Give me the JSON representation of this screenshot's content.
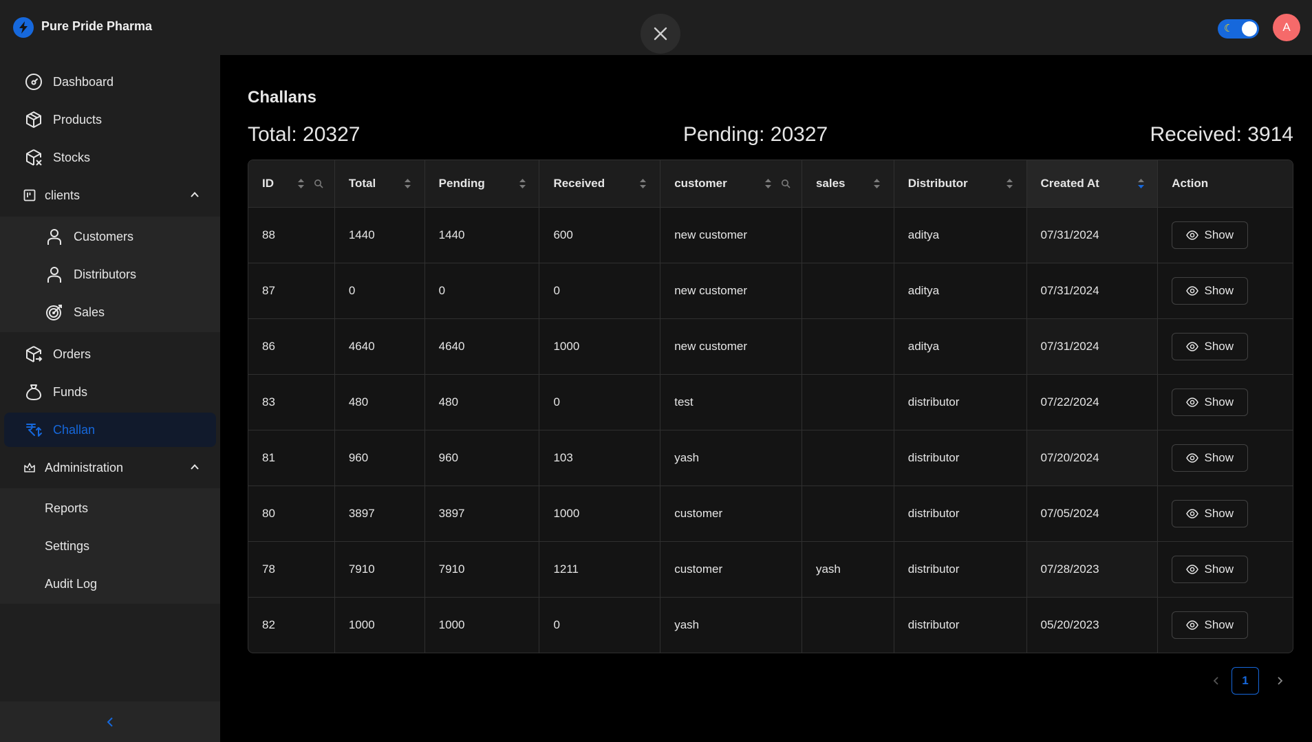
{
  "app": {
    "title": "Pure Pride Pharma",
    "avatar_letter": "A"
  },
  "colors": {
    "accent": "#1668dc",
    "avatar": "#f56a6a",
    "header": "#1f1f1f",
    "sidebar": "#1f1f1f"
  },
  "sidebar": {
    "items": [
      {
        "label": "Dashboard",
        "icon": "dashboard-icon"
      },
      {
        "label": "Products",
        "icon": "box-icon"
      },
      {
        "label": "Stocks",
        "icon": "box-settings-icon"
      },
      {
        "label": "clients",
        "icon": "kanban-icon"
      },
      {
        "label": "Customers",
        "icon": "user-icon"
      },
      {
        "label": "Distributors",
        "icon": "user-icon"
      },
      {
        "label": "Sales",
        "icon": "target-icon"
      },
      {
        "label": "Orders",
        "icon": "box-arrow-icon"
      },
      {
        "label": "Funds",
        "icon": "money-bag-icon"
      },
      {
        "label": "Challan",
        "icon": "rupee-icon"
      },
      {
        "label": "Administration",
        "icon": "crown-icon"
      },
      {
        "label": "Reports"
      },
      {
        "label": "Settings"
      },
      {
        "label": "Audit Log"
      }
    ],
    "active": "Challan"
  },
  "page": {
    "title": "Challans",
    "total": "Total: 20327",
    "pending": "Pending: 20327",
    "received": "Received: 3914"
  },
  "table": {
    "columns": [
      "ID",
      "Total",
      "Pending",
      "Received",
      "customer",
      "sales",
      "Distributor",
      "Created At",
      "Action"
    ],
    "rows": [
      [
        "88",
        "1440",
        "1440",
        "600",
        "new customer",
        "",
        "aditya",
        "07/31/2024",
        "Show"
      ],
      [
        "87",
        "0",
        "0",
        "0",
        "new customer",
        "",
        "aditya",
        "07/31/2024",
        "Show"
      ],
      [
        "86",
        "4640",
        "4640",
        "1000",
        "new customer",
        "",
        "aditya",
        "07/31/2024",
        "Show"
      ],
      [
        "83",
        "480",
        "480",
        "0",
        "test",
        "",
        "distributor",
        "07/22/2024",
        "Show"
      ],
      [
        "81",
        "960",
        "960",
        "103",
        "yash",
        "",
        "distributor",
        "07/20/2024",
        "Show"
      ],
      [
        "80",
        "3897",
        "3897",
        "1000",
        "customer",
        "",
        "distributor",
        "07/05/2024",
        "Show"
      ],
      [
        "78",
        "7910",
        "7910",
        "1211",
        "customer",
        "yash",
        "distributor",
        "07/28/2023",
        "Show"
      ],
      [
        "82",
        "1000",
        "1000",
        "0",
        "yash",
        "",
        "distributor",
        "05/20/2023",
        "Show"
      ]
    ]
  },
  "pagination": {
    "current": "1"
  }
}
